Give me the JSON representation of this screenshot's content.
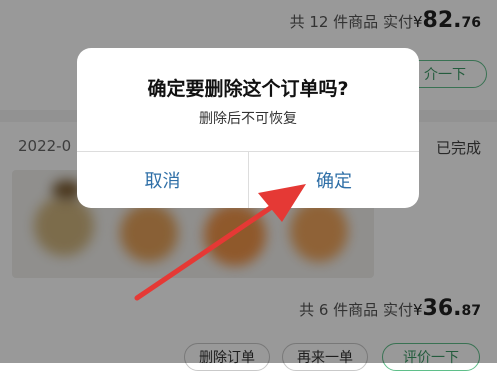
{
  "order_top": {
    "summary_prefix": "共 12 件商品",
    "paid_label": "实付",
    "currency": "¥",
    "amount_int": "82.",
    "amount_dec": "76",
    "partial_button_label": "介一下"
  },
  "order_second": {
    "date_partial": "2022-0",
    "status": "已完成",
    "summary_prefix": "共 6 件商品",
    "paid_label": "实付",
    "currency": "¥",
    "amount_int": "36.",
    "amount_dec": "87",
    "buttons": [
      "删除订单",
      "再来一单",
      "评价一下"
    ]
  },
  "dialog": {
    "title": "确定要删除这个订单吗?",
    "message": "删除后不可恢复",
    "cancel_label": "取消",
    "confirm_label": "确定"
  },
  "colors": {
    "dialog_button_text": "#2f6fa7",
    "annotation_arrow": "#e53935",
    "accent_green": "#3c9a66"
  }
}
